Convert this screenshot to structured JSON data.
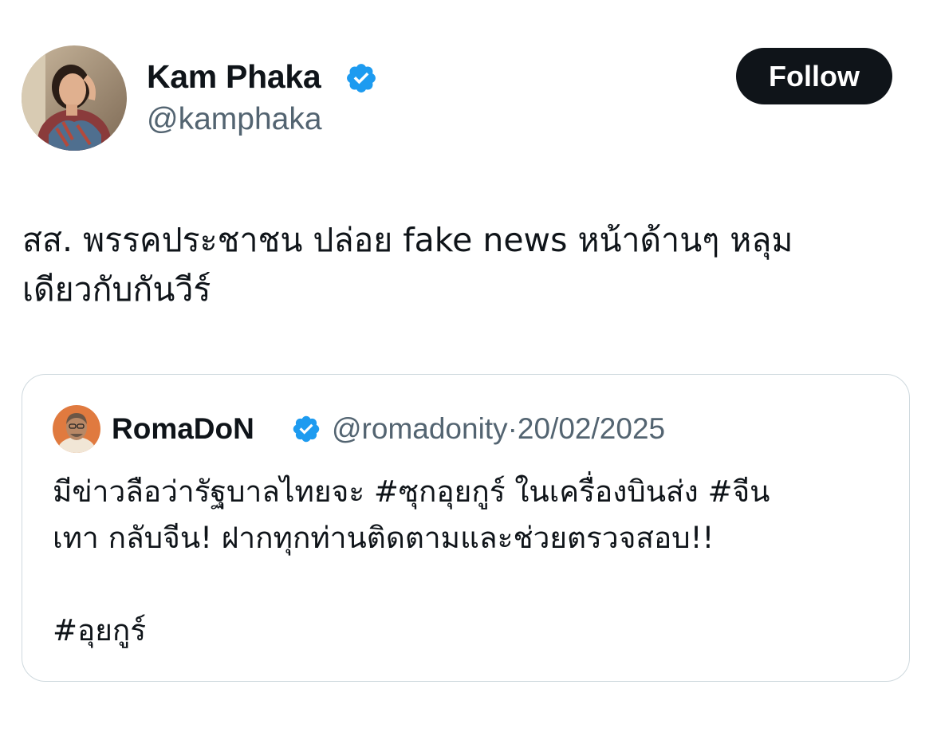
{
  "author": {
    "display_name": "Kam Phaka",
    "handle": "@kamphaka",
    "verified": true,
    "avatar_icon": "profile-photo-woman"
  },
  "follow_button": {
    "label": "Follow"
  },
  "tweet": {
    "lines": [
      "สส. พรรคประชาชน ปล่อย fake news หน้าด้านๆ หลุม",
      "เดียวกับกันวีร์"
    ]
  },
  "quoted_tweet": {
    "display_name": "RomaDoN",
    "handle": "@romadonity",
    "separator": "·",
    "date": "20/02/2025",
    "verified": true,
    "avatar_icon": "profile-photo-man",
    "lines": [
      "มีข่าวลือว่ารัฐบาลไทยจะ #ซุกอุยกูร์ ในเครื่องบินส่ง #จีน",
      "เทา กลับจีน! ฝากทุกท่านติดตามและช่วยตรวจสอบ!!"
    ],
    "hashtag_line": "#อุยกูร์"
  },
  "colors": {
    "verified_badge": "#1d9bf0",
    "secondary_text": "#536471",
    "follow_button_bg": "#0f1419",
    "card_border": "#cfd9de"
  }
}
